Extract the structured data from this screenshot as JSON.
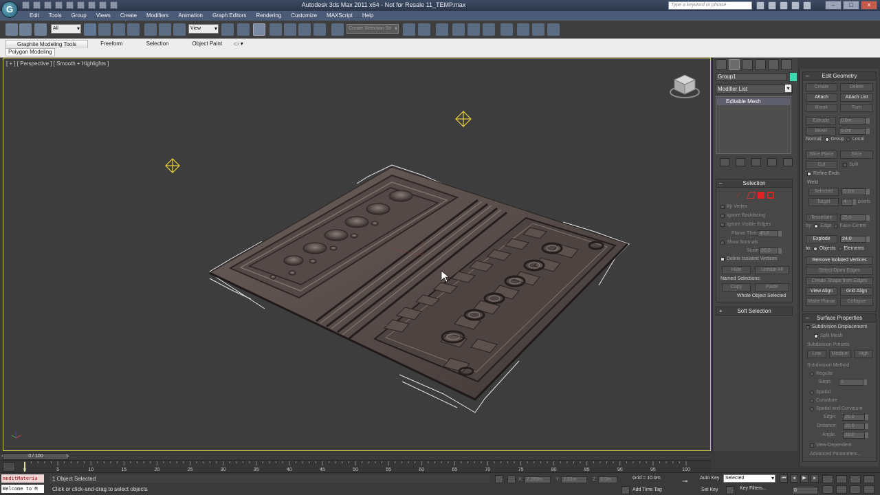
{
  "titlebar": {
    "title": "Autodesk 3ds Max  2011 x64   - Not for Resale   11_TEMP.max",
    "help_search_placeholder": "Type a keyword or phrase",
    "logo_letter": "G",
    "minimize": "–",
    "maximize": "□",
    "close": "×"
  },
  "menu": [
    "Edit",
    "Tools",
    "Group",
    "Views",
    "Create",
    "Modifiers",
    "Animation",
    "Graph Editors",
    "Rendering",
    "Customize",
    "MAXScript",
    "Help"
  ],
  "toolbar": {
    "selection_filter": "All",
    "ref_coord": "View",
    "named_selection": "Create Selection Se"
  },
  "ribbon": {
    "tabs": [
      "Graphite Modeling Tools",
      "Freeform",
      "Selection",
      "Object Paint"
    ],
    "panel_label": "Polygon Modeling",
    "options_glyph": "▭ ▾"
  },
  "viewport": {
    "label": "[ + ] [ Perspective ] [ Smooth + Highlights ]"
  },
  "command_panel": {
    "object_name": "Group1",
    "object_color": "#3dd9b0",
    "modifier_list": "Modifier List",
    "stack_item": "Editable Mesh",
    "selection": {
      "title": "Selection",
      "by_vertex": "By Vertex",
      "ignore_backfacing": "Ignore Backfacing",
      "ignore_visible_edges": "Ignore Visible Edges",
      "planar_thresh_label": "Planar Thresh",
      "planar_thresh_value": "45.0",
      "show_normals": "Show Normals",
      "scale_label": "Scale",
      "scale_value": "20.0",
      "delete_isolated": "Delete Isolated Vertices",
      "hide": "Hide",
      "unhide_all": "Unhide All",
      "named_selections": "Named Selections:",
      "copy": "Copy",
      "paste": "Paste",
      "whole_object": "Whole Object Selected"
    },
    "soft_selection": "Soft Selection"
  },
  "edit_geometry": {
    "title": "Edit Geometry",
    "create": "Create",
    "delete": "Delete",
    "attach": "Attach",
    "attach_list": "Attach List",
    "break": "Break",
    "turn": "Turn",
    "extrude": "Extrude",
    "extrude_value": "0.0m",
    "bevel": "Bevel",
    "bevel_value": "0.0m",
    "normal_label": "Normal:",
    "group": "Group",
    "local": "Local",
    "slice_plane": "Slice Plane",
    "slice": "Slice",
    "cut": "Cut",
    "split": "Split",
    "refine_ends": "Refine Ends",
    "weld": "Weld",
    "selected": "Selected",
    "selected_value": "0.1m",
    "target": "Target",
    "target_value": "4",
    "pixels": "pixels",
    "tessellate": "Tessellate",
    "tessellate_value": "25.0",
    "by_label": "by:",
    "edge": "Edge",
    "face_center": "Face-Center",
    "explode": "Explode",
    "explode_value": "24.0",
    "to_label": "to:",
    "objects": "Objects",
    "elements": "Elements",
    "remove_isolated": "Remove Isolated Vertices",
    "select_open_edges": "Select Open Edges",
    "create_shape": "Create Shape from Edges",
    "view_align": "View Align",
    "grid_align": "Grid Align",
    "make_planar": "Make Planar",
    "collapse": "Collapse"
  },
  "surface_properties": {
    "title": "Surface Properties",
    "subdiv_displacement": "Subdivision Displacement",
    "split_mesh": "Split Mesh",
    "presets_label": "Subdivision Presets",
    "low": "Low",
    "medium": "Medium",
    "high": "High",
    "method_label": "Subdivision Method",
    "regular": "Regular",
    "steps_label": "Steps:",
    "steps_value": "2",
    "spatial": "Spatial",
    "curvature": "Curvature",
    "spatial_curvature": "Spatial and Curvature",
    "edge_label": "Edge:",
    "edge_value": "20.0",
    "distance_label": "Distance:",
    "distance_value": "20.0",
    "angle_label": "Angle:",
    "angle_value": "10.0",
    "view_dependent": "View-Dependent",
    "advanced": "Advanced Parameters..."
  },
  "timeline": {
    "thumb": "0 / 100",
    "arrow_left": "<",
    "arrow_right": ">",
    "ticks": [
      "0",
      "5",
      "10",
      "15",
      "20",
      "25",
      "30",
      "35",
      "40",
      "45",
      "50",
      "55",
      "60",
      "65",
      "70",
      "75",
      "80",
      "85",
      "90",
      "95",
      "100"
    ]
  },
  "status": {
    "maxscript_a": "meditMateria",
    "maxscript_b": "Welcome to M",
    "selection_count": "1 Object Selected",
    "prompt": "Click or click-and-drag to select objects",
    "x_label": "X:",
    "x_value": "2.289m",
    "y_label": "Y:",
    "y_value": "2.61m",
    "z_label": "Z:",
    "z_value": "0.0m",
    "grid": "Grid = 10.0m",
    "add_time_tag": "Add Time Tag",
    "auto_key": "Auto Key",
    "set_key": "Set Key",
    "key_mode": "Selected",
    "key_filters": "Key Filters...",
    "frame": "0",
    "key_glyph": "⊸"
  },
  "colors": {
    "viewport_bg": "#3d3d3d",
    "mesh": "#5a4f4c",
    "helper": "#e8d23a",
    "active_border": "#c9c94a"
  }
}
